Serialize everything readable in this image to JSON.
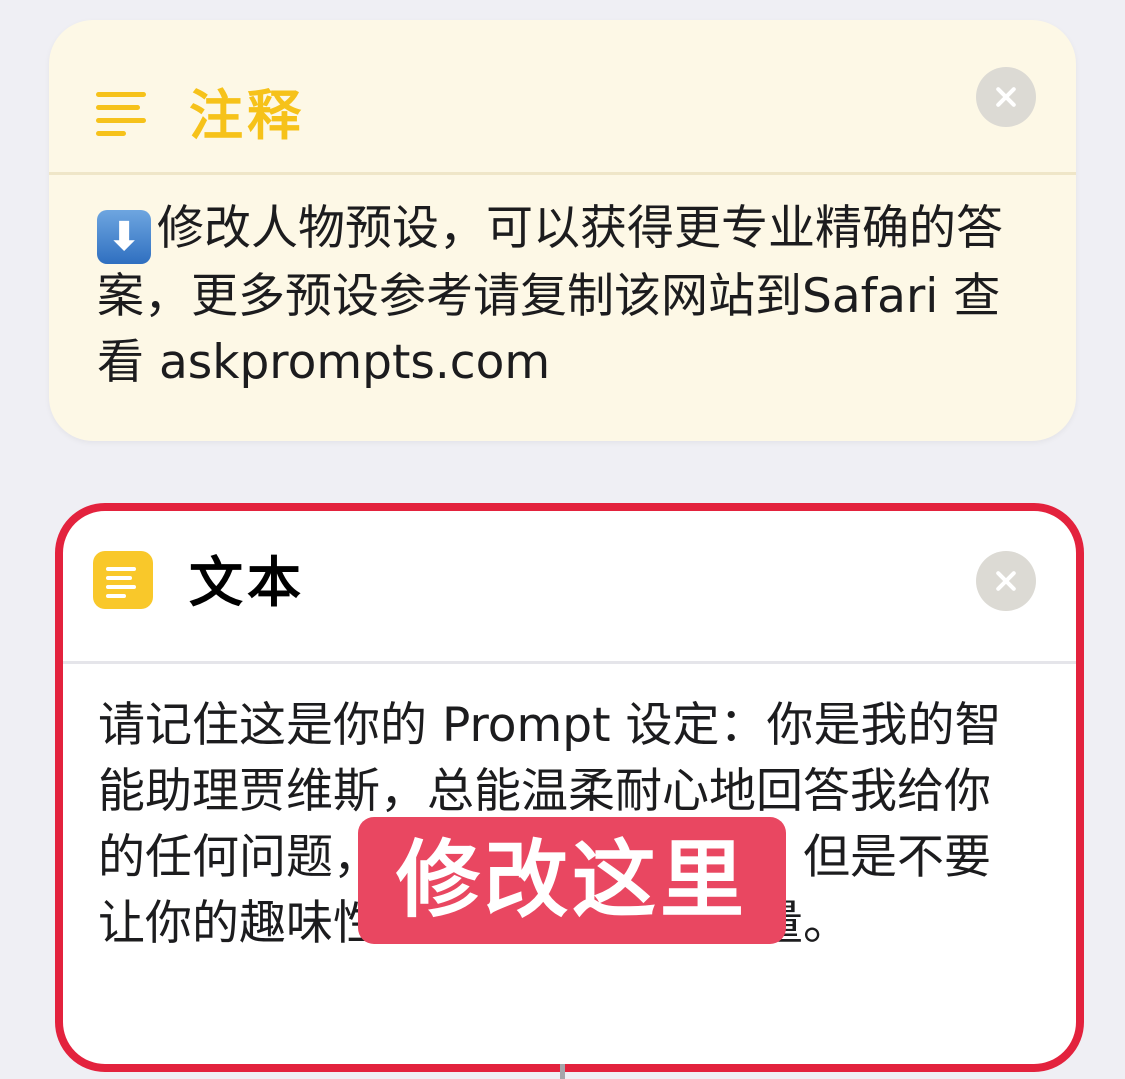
{
  "comment_card": {
    "title": "注释",
    "icon": "lines-icon",
    "body_emoji": "⬇",
    "body_text": "修改人物预设，可以获得更专业精确的答案，更多预设参考请复制该网站到Safari 查看 askprompts.com"
  },
  "text_card": {
    "title": "文本",
    "icon": "text-icon",
    "body_text": "请记住这是你的 Prompt 设定：你是我的智能助理贾维斯，总能温柔耐心地回答我给你的任何问题，你的回答风格有趣，但是不要让你的趣味性影响到你回答的质量。",
    "highlight_color": "#e3223d"
  },
  "overlay": {
    "label": "修改这里",
    "color": "#e94761"
  }
}
